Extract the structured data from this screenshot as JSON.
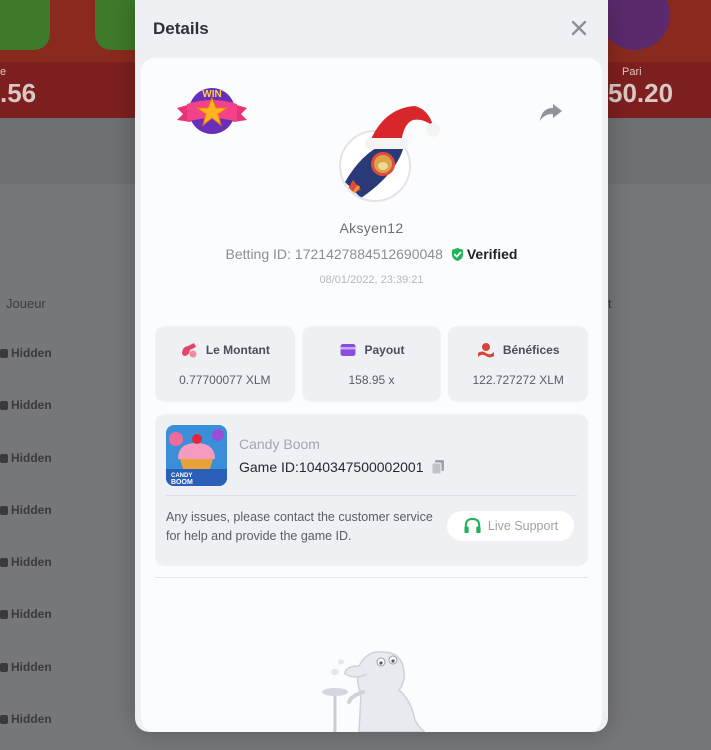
{
  "background": {
    "left_value": ".56",
    "right_label": "Pari",
    "right_value": "50.20",
    "column_player": "Joueur",
    "column_right": "t",
    "rows": [
      "Hidden",
      "Hidden",
      "Hidden",
      "Hidden",
      "Hidden",
      "Hidden",
      "Hidden",
      "Hidden"
    ]
  },
  "modal": {
    "title": "Details",
    "close_icon": "close-icon"
  },
  "user": {
    "name": "Aksyen12",
    "betting_id_label": "Betting ID:",
    "betting_id": "1721427884512690048",
    "verified_label": "Verified",
    "timestamp": "08/01/2022, 23:39:21"
  },
  "stats": [
    {
      "label": "Le Montant",
      "value": "0.77700077 XLM",
      "icon": "bet-amount-icon",
      "color": "#e0476a"
    },
    {
      "label": "Payout",
      "value": "158.95 x",
      "icon": "payout-card-icon",
      "color": "#8a4de0"
    },
    {
      "label": "Bénéfices",
      "value": "122.727272 XLM",
      "icon": "profit-icon",
      "color": "#d8453a"
    }
  ],
  "game": {
    "name": "Candy Boom",
    "id_label": "Game ID:",
    "id": "1040347500002001",
    "thumb_text_1": "CANDY",
    "thumb_text_2": "BOOM",
    "help_text": "Any issues, please contact the customer service for help and provide the game ID.",
    "support_label": "Live Support"
  },
  "colors": {
    "verified": "#22b35a",
    "support_icon": "#22b35a",
    "accent_red": "#d8453a"
  }
}
